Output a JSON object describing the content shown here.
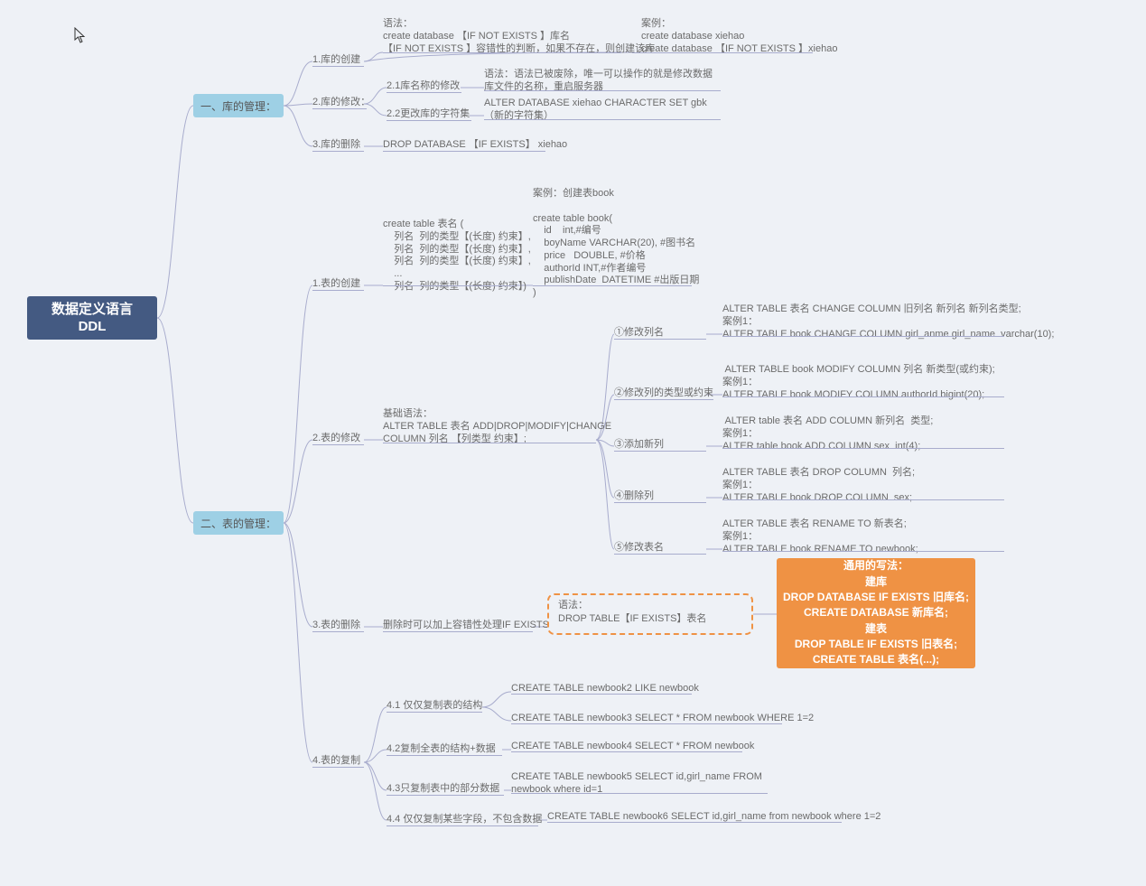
{
  "root": "数据定义语言\nDDL",
  "l1a": "一、库的管理：",
  "l1b": "二、表的管理：",
  "lib_create_label": "1.库的创建",
  "lib_create_syntax": "语法：\ncreate database 【IF NOT EXISTS 】库名\n【IF NOT EXISTS 】容错性的判断，如果不存在，则创建该库",
  "lib_create_example": "案例：\ncreate database xiehao\ncreate database 【IF NOT EXISTS 】xiehao",
  "lib_modify_label": "2.库的修改：",
  "lib_modify_name_label": "2.1库名称的修改",
  "lib_modify_name_text": "语法：语法已被废除，唯一可以操作的就是修改数据库文件的名称，重启服务器",
  "lib_modify_charset_label": "2.2更改库的字符集",
  "lib_modify_charset_text": "ALTER DATABASE xiehao CHARACTER SET gbk（新的字符集）",
  "lib_drop_label": "3.库的删除",
  "lib_drop_text": "DROP DATABASE 【IF EXISTS】 xiehao",
  "tbl_create_label": "1.表的创建",
  "tbl_create_syntax": "create table 表名 (\n    列名  列的类型【(长度) 约束】,\n    列名  列的类型【(长度) 约束】,\n    列名  列的类型【(长度) 约束】,\n    ...\n    列名  列的类型【(长度) 约束】)",
  "tbl_create_example": "案例：创建表book\n\ncreate table book(\n    id    int,#编号\n    boyName VARCHAR(20), #图书名\n    price   DOUBLE, #价格\n    authorId INT,#作者编号\n    publishDate  DATETIME #出版日期\n)",
  "tbl_modify_label": "2.表的修改",
  "tbl_modify_base": "基础语法：\nALTER TABLE 表名 ADD|DROP|MODIFY|CHANGE\nCOLUMN 列名 【列类型 约束】;",
  "mod1_label": "①修改列名",
  "mod1_text": "ALTER TABLE 表名 CHANGE COLUMN 旧列名 新列名 新列名类型;\n案例1：\nALTER TABLE book CHANGE COLUMN girl_anme girl_name  varchar(10);",
  "mod2_label": "②修改列的类型或约束",
  "mod2_text": " ALTER TABLE book MODIFY COLUMN 列名 新类型(或约束);\n案例1：\nALTER TABLE book MODIFY COLUMN authorId bigint(20);",
  "mod3_label": "③添加新列",
  "mod3_text": " ALTER table 表名 ADD COLUMN 新列名  类型;\n案例1：\nALTER table book ADD COLUMN sex  int(4);",
  "mod4_label": "④删除列",
  "mod4_text": "ALTER TABLE 表名 DROP COLUMN  列名;\n案例1：\nALTER TABLE book DROP COLUMN  sex;",
  "mod5_label": "⑤修改表名",
  "mod5_text": "ALTER TABLE 表名 RENAME TO 新表名;\n案例1：\nALTER TABLE book RENAME TO newbook;",
  "tbl_drop_label": "3.表的删除",
  "tbl_drop_text": "删除时可以加上容错性处理IF EXISTS",
  "tbl_drop_box": "语法：\nDROP TABLE【IF EXISTS】表名",
  "orange": "通用的写法：\n建库\nDROP DATABASE IF EXISTS 旧库名;\nCREATE DATABASE 新库名;\n建表\nDROP TABLE IF EXISTS 旧表名;\nCREATE TABLE 表名(...);",
  "tbl_copy_label": "4.表的复制",
  "copy1_label": "4.1 仅仅复制表的结构",
  "copy1a": "CREATE TABLE newbook2 LIKE newbook",
  "copy1b": "CREATE TABLE newbook3 SELECT * FROM newbook WHERE 1=2",
  "copy2_label": "4.2复制全表的结构+数据",
  "copy2_text": "CREATE TABLE newbook4 SELECT * FROM newbook",
  "copy3_label": "4.3只复制表中的部分数据",
  "copy3_text": "CREATE TABLE newbook5 SELECT id,girl_name FROM newbook where id=1",
  "copy4_label": "4.4 仅仅复制某些字段，不包含数据",
  "copy4_text": "CREATE TABLE newbook6 SELECT id,girl_name from newbook where 1=2"
}
